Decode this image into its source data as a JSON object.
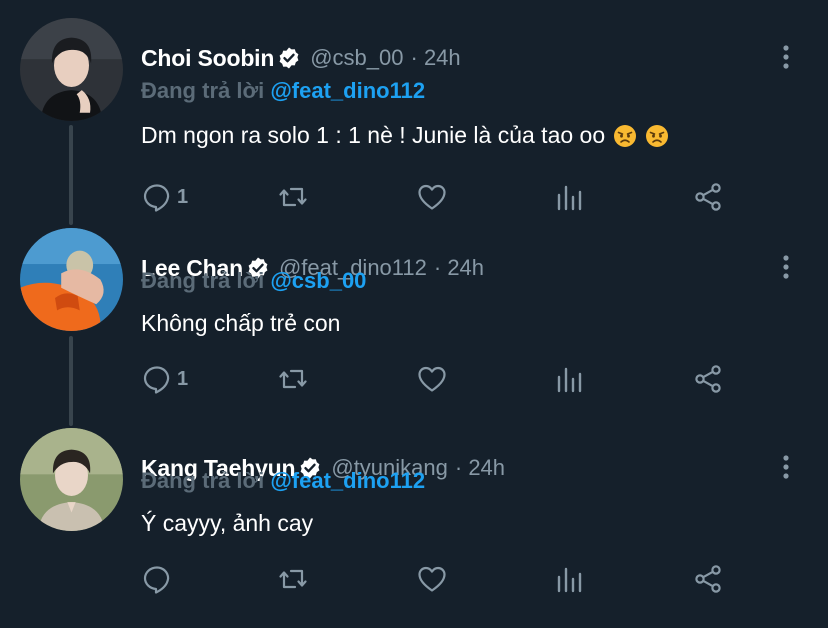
{
  "tweets": [
    {
      "name": "Choi Soobin",
      "handle": "@csb_00",
      "time": "· 24h",
      "reply_label": "Đang trả lời",
      "reply_handle": "@feat_dino112",
      "text": "Dm ngon ra solo 1 : 1 nè ! Junie là của tao oo",
      "emojis": [
        "angry-face-emoji",
        "angry-face-emoji"
      ],
      "reply_count": "1",
      "avatar_colors": {
        "bg": "#2e3238",
        "hair": "#1a1c20",
        "skin": "#e8cfc0"
      }
    },
    {
      "name": "Lee Chan",
      "handle": "@feat_dino112",
      "time": "· 24h",
      "reply_label": "Đang trả lời",
      "reply_handle": "@csb_00",
      "text": "Không chấp trẻ con",
      "emojis": [],
      "reply_count": "1",
      "avatar_colors": {
        "bg": "#2f7fb8",
        "float": "#ef6a1c",
        "skin": "#e6b9a3"
      }
    },
    {
      "name": "Kang Taehyun",
      "handle": "@tyunikang",
      "time": "· 24h",
      "reply_label": "Đang trả lời",
      "reply_handle": "@feat_dino112",
      "text": "Ý cayyy, ảnh cay",
      "emojis": [],
      "reply_count": "",
      "avatar_colors": {
        "bg": "#8a9a6e",
        "hair": "#2a2521",
        "skin": "#e9d6c8"
      }
    }
  ],
  "icons": [
    "reply-icon",
    "retweet-icon",
    "like-icon",
    "analytics-icon",
    "share-icon",
    "more-icon",
    "verified-badge-icon"
  ],
  "colors": {
    "background": "#15202b",
    "text_primary": "#ffffff",
    "text_secondary": "#8899a6",
    "reply_label": "#5b6b78",
    "link": "#1da1f2",
    "thread_line": "#38444d"
  }
}
